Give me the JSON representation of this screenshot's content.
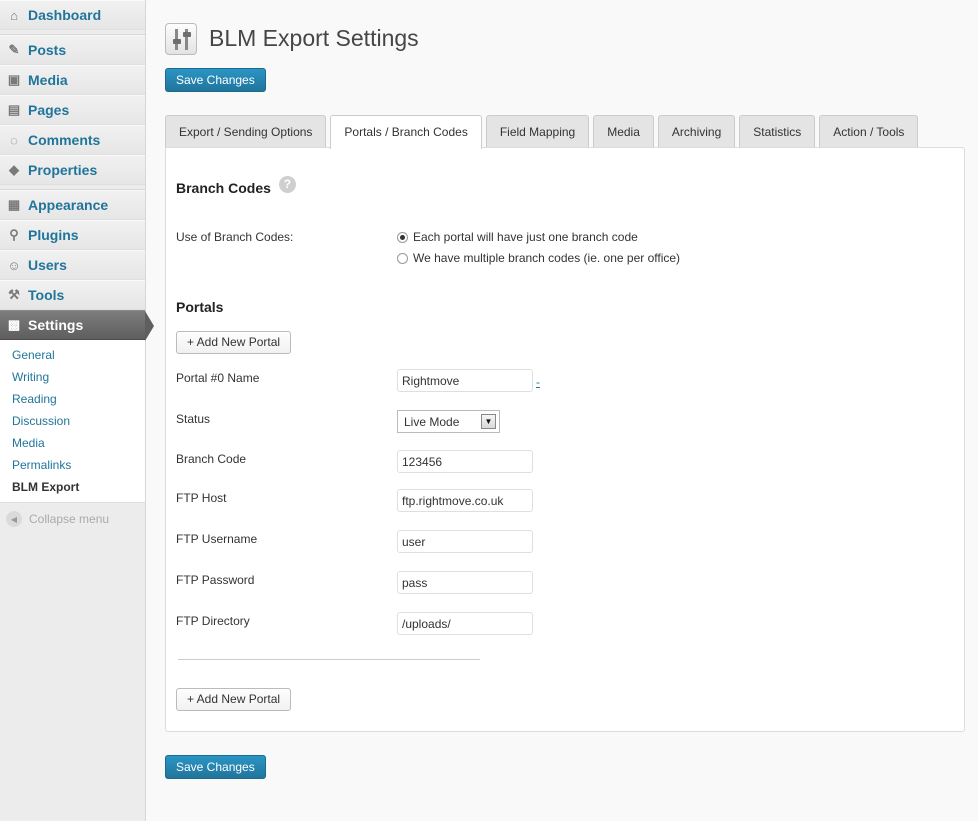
{
  "sidebar": {
    "top_items": [
      {
        "label": "Dashboard",
        "icon": "dashboard-icon"
      }
    ],
    "group1": [
      {
        "label": "Posts",
        "icon": "pushpin-icon"
      },
      {
        "label": "Media",
        "icon": "media-icon"
      },
      {
        "label": "Pages",
        "icon": "pages-icon"
      },
      {
        "label": "Comments",
        "icon": "comment-icon"
      },
      {
        "label": "Properties",
        "icon": "properties-icon"
      }
    ],
    "group2": [
      {
        "label": "Appearance",
        "icon": "appearance-icon"
      },
      {
        "label": "Plugins",
        "icon": "plugin-icon"
      },
      {
        "label": "Users",
        "icon": "users-icon"
      },
      {
        "label": "Tools",
        "icon": "tools-icon"
      },
      {
        "label": "Settings",
        "icon": "settings-icon"
      }
    ],
    "submenu": [
      "General",
      "Writing",
      "Reading",
      "Discussion",
      "Media",
      "Permalinks",
      "BLM Export"
    ],
    "collapse_label": "Collapse menu"
  },
  "page": {
    "title": "BLM Export Settings",
    "save_label": "Save Changes"
  },
  "tabs": [
    "Export / Sending Options",
    "Portals / Branch Codes",
    "Field Mapping",
    "Media",
    "Archiving",
    "Statistics",
    "Action / Tools"
  ],
  "branch": {
    "heading": "Branch Codes",
    "help_glyph": "?",
    "use_label": "Use of Branch Codes:",
    "options": [
      "Each portal will have just one branch code",
      "We have multiple branch codes (ie. one per office)"
    ],
    "selected_index": 0
  },
  "portals": {
    "heading": "Portals",
    "add_label": "+ Add New Portal",
    "remove_link": "-",
    "fields": {
      "name_label": "Portal #0 Name",
      "name_value": "Rightmove",
      "status_label": "Status",
      "status_value": "Live Mode",
      "branch_label": "Branch Code",
      "branch_value": "123456",
      "host_label": "FTP Host",
      "host_value": "ftp.rightmove.co.uk",
      "user_label": "FTP Username",
      "user_value": "user",
      "pass_label": "FTP Password",
      "pass_value": "pass",
      "dir_label": "FTP Directory",
      "dir_value": "/uploads/"
    }
  },
  "colors": {
    "primary": "#21759b",
    "sidebar_bg": "#ececec",
    "active_menu": "#6b6b6b"
  }
}
